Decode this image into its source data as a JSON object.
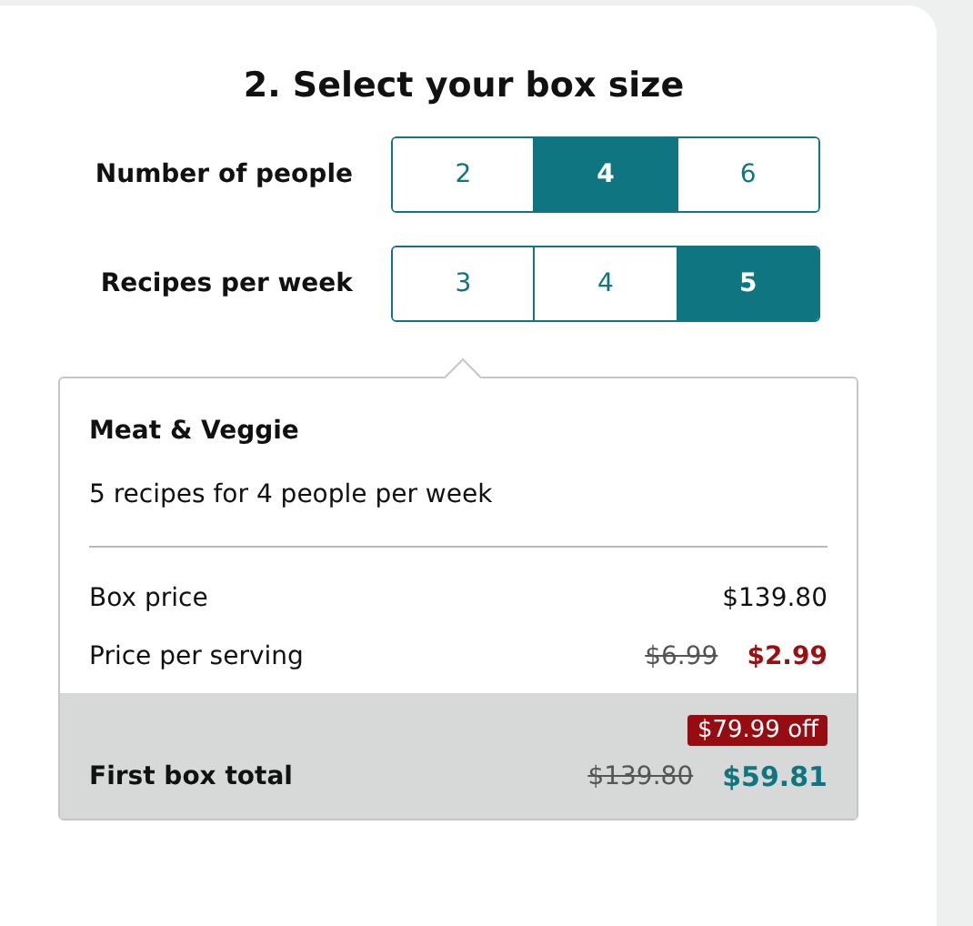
{
  "title": "2. Select your box size",
  "options": [
    {
      "label": "Number of people",
      "choices": [
        {
          "label": "2",
          "selected": false
        },
        {
          "label": "4",
          "selected": true
        },
        {
          "label": "6",
          "selected": false
        }
      ]
    },
    {
      "label": "Recipes per week",
      "choices": [
        {
          "label": "3",
          "selected": false
        },
        {
          "label": "4",
          "selected": false
        },
        {
          "label": "5",
          "selected": true
        }
      ]
    }
  ],
  "summary": {
    "plan": "Meat & Veggie",
    "description": "5 recipes for 4 people per week",
    "lines": [
      {
        "label": "Box price",
        "price": "$139.80",
        "kind": "plain"
      },
      {
        "label": "Price per serving",
        "old_price": "$6.99",
        "price": "$2.99",
        "kind": "discount"
      }
    ],
    "discount_badge": "$79.99 off",
    "total": {
      "label": "First box total",
      "old_price": "$139.80",
      "price": "$59.81"
    }
  }
}
